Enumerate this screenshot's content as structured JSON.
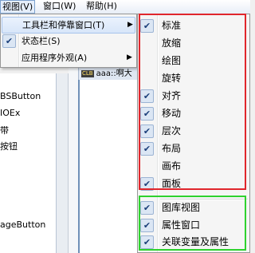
{
  "menubar": {
    "items": [
      {
        "label": "视图(V)",
        "active": true
      },
      {
        "label": "窗口(W)"
      },
      {
        "label": "帮助(H)"
      }
    ]
  },
  "background": {
    "left_panel_texts": [
      "BSButton",
      "IOEx",
      "带",
      "按钮",
      "ageButton"
    ],
    "doc_tab": {
      "badge": "CLB",
      "label": "aaa::啊大"
    }
  },
  "view_menu": {
    "items": [
      {
        "label": "工具栏和停靠窗口(T)",
        "checked": false,
        "submenu": true,
        "highlighted": true
      },
      {
        "label": "状态栏(S)",
        "checked": true,
        "submenu": false
      },
      {
        "label": "应用程序外观(A)",
        "checked": false,
        "submenu": true
      }
    ]
  },
  "toolbar_submenu": {
    "items": [
      {
        "label": "标准",
        "checked": true
      },
      {
        "label": "放缩",
        "checked": false
      },
      {
        "label": "绘图",
        "checked": false
      },
      {
        "label": "旋转",
        "checked": false
      },
      {
        "label": "对齐",
        "checked": true
      },
      {
        "label": "移动",
        "checked": true
      },
      {
        "label": "层次",
        "checked": true
      },
      {
        "label": "布局",
        "checked": true
      },
      {
        "label": "画布",
        "checked": false
      },
      {
        "label": "面板",
        "checked": true
      },
      {
        "label": "图库视图",
        "checked": true
      },
      {
        "label": "属性窗口",
        "checked": true
      },
      {
        "label": "关联变量及属性",
        "checked": true
      }
    ]
  },
  "icons": {
    "check": "✔",
    "submenu_arrow": "▶"
  },
  "colors": {
    "red_highlight": "#e0262c",
    "green_highlight": "#2ed22e"
  }
}
